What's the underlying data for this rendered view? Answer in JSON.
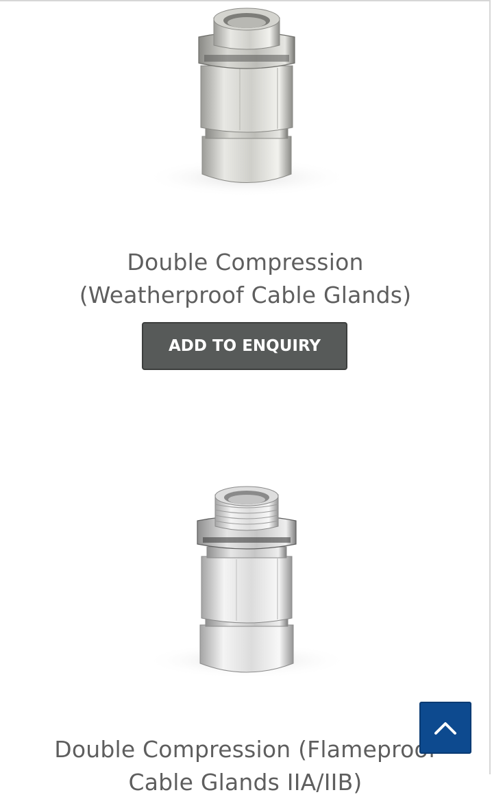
{
  "products": [
    {
      "title_line1": "Double Compression",
      "title_line2": "(Weatherproof Cable Glands)",
      "button_label": "ADD TO ENQUIRY",
      "image_icon": "cable-gland-image"
    },
    {
      "title_line1": "Double Compression (Flameproof",
      "title_line2": "Cable Glands IIA/IIB)",
      "image_icon": "cable-gland-image"
    }
  ],
  "back_to_top": {
    "icon": "chevron-up-icon"
  },
  "colors": {
    "title_text": "#5e5e5e",
    "button_bg": "#575a59",
    "back_to_top_bg": "#0d4a8f"
  }
}
